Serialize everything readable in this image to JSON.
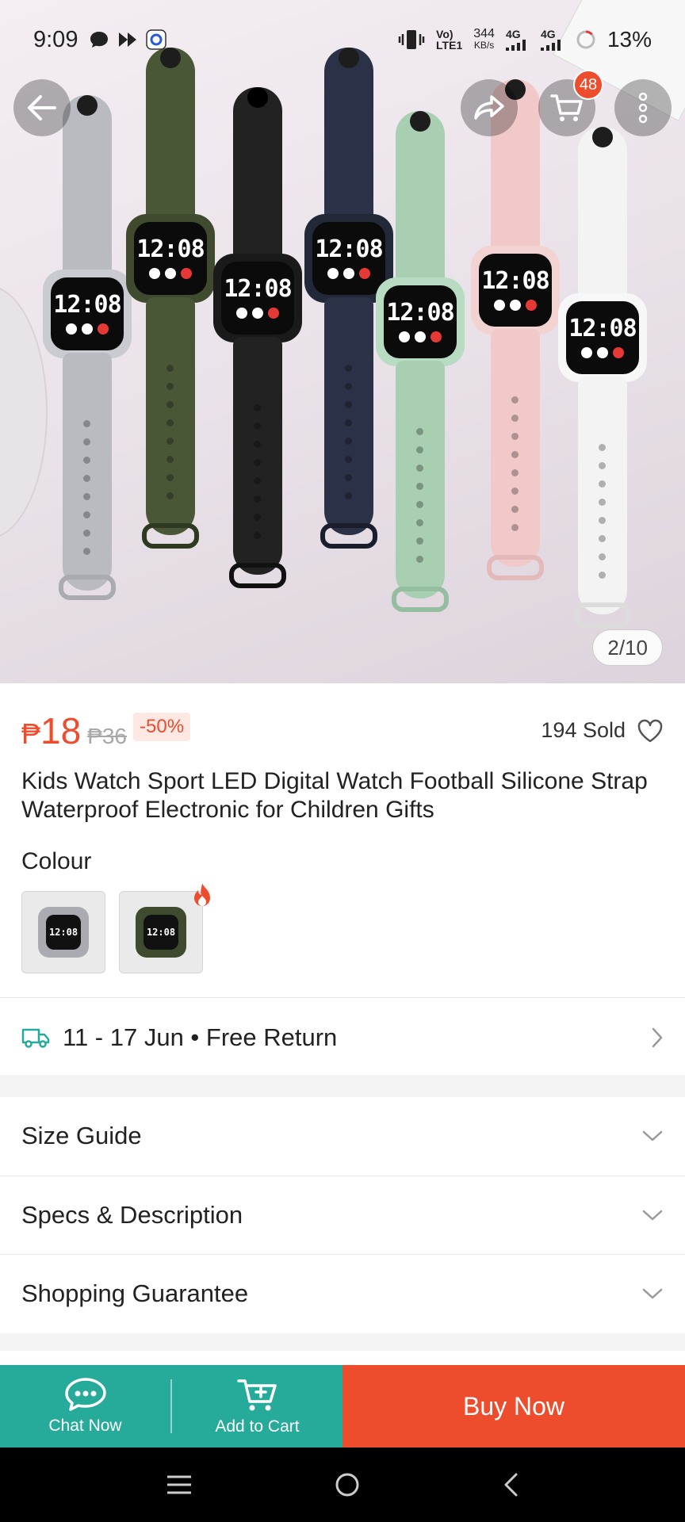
{
  "status_bar": {
    "time": "9:09",
    "network_top": "Vo)",
    "network_bottom": "LTE1",
    "speed_value": "344",
    "speed_unit": "KB/s",
    "sim1": "4G",
    "sim2": "4G",
    "battery": "13%"
  },
  "header": {
    "cart_count": "48",
    "back_icon": "arrow-left-icon",
    "share_icon": "share-icon",
    "cart_icon": "cart-icon",
    "more_icon": "more-vertical-icon"
  },
  "gallery": {
    "counter": "2/10",
    "watch_time": "12:08"
  },
  "product": {
    "currency": "₱",
    "price": "18",
    "old_price": "₱36",
    "discount": "-50%",
    "sold": "194 Sold",
    "title": "Kids Watch Sport LED Digital Watch Football Silicone Strap Waterproof Electronic for Children Gifts"
  },
  "colour": {
    "label": "Colour",
    "options": [
      {
        "swatch_color": "#a9abb0",
        "selected": false
      },
      {
        "swatch_color": "#3f4a2e",
        "selected": false,
        "hot": true
      }
    ]
  },
  "delivery": {
    "text": "11 - 17 Jun • Free Return",
    "icon": "truck-icon"
  },
  "sections": [
    {
      "label": "Size Guide"
    },
    {
      "label": "Specs & Description"
    },
    {
      "label": "Shopping Guarantee"
    }
  ],
  "actions": {
    "chat": "Chat Now",
    "add_to_cart": "Add to Cart",
    "buy_now": "Buy Now"
  },
  "colors": {
    "brand_orange": "#ee4d2d",
    "teal": "#26aa99"
  }
}
